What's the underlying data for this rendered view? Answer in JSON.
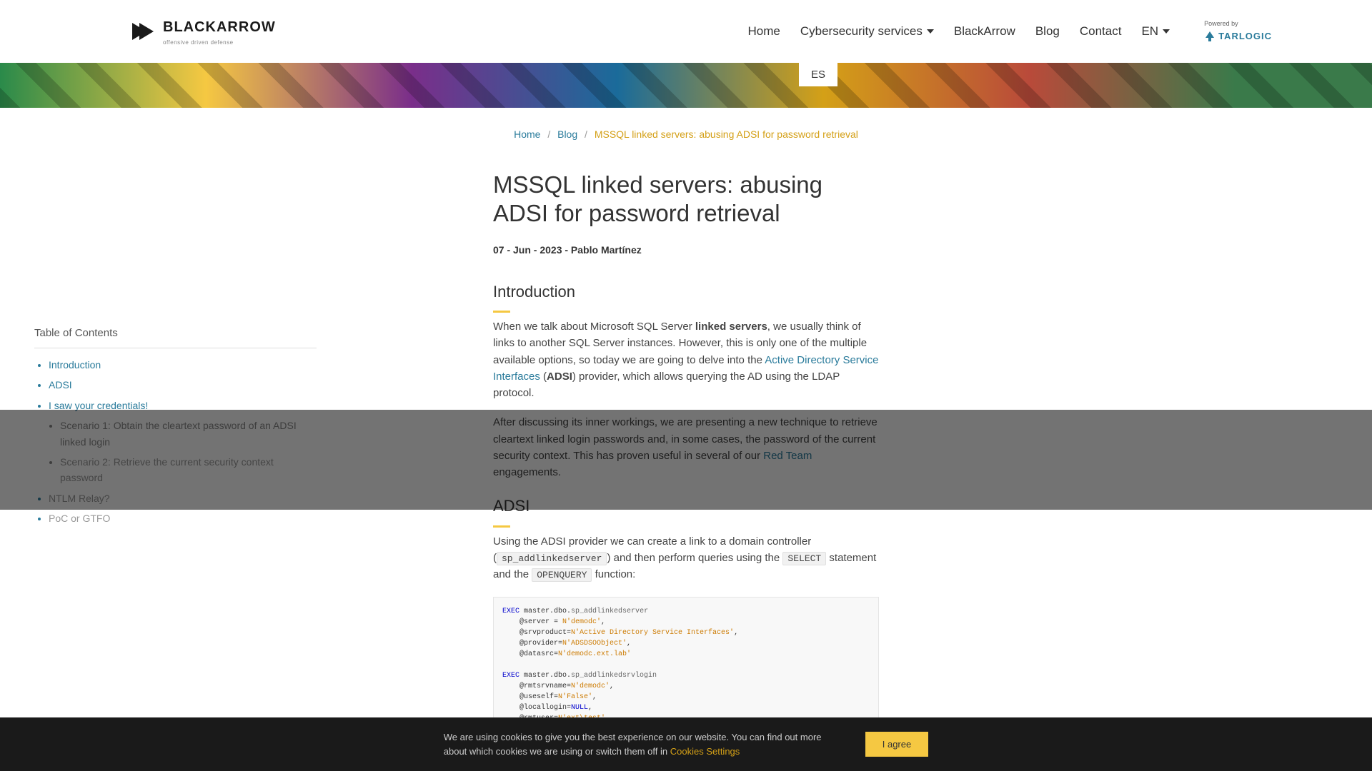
{
  "header": {
    "logo_main": "BLACKARROW",
    "logo_sub": "offensive driven defense",
    "nav": {
      "home": "Home",
      "services": "Cybersecurity services",
      "blackarrow": "BlackArrow",
      "blog": "Blog",
      "contact": "Contact",
      "lang": "EN"
    },
    "powered_label": "Powered by",
    "tarlogic": "TARLOGIC"
  },
  "lang_switch": "ES",
  "breadcrumb": {
    "home": "Home",
    "blog": "Blog",
    "current": "MSSQL linked servers: abusing ADSI for password retrieval"
  },
  "article": {
    "title": "MSSQL linked servers: abusing ADSI for password retrieval",
    "meta": "07 - Jun - 2023 - Pablo Martínez",
    "h_intro": "Introduction",
    "p1_a": "When we talk about Microsoft SQL Server ",
    "p1_strong": "linked servers",
    "p1_b": ", we usually think of links to another SQL Server instances. However, this is only one of the multiple available options, so today we are going to delve into the ",
    "p1_link": "Active Directory Service Interfaces",
    "p1_c": " (",
    "p1_strong2": "ADSI",
    "p1_d": ") provider, which allows querying the AD using the LDAP protocol.",
    "p2_a": "After discussing its inner workings, we are presenting a new technique to retrieve cleartext linked login passwords and, in some cases, the password of the current security context. This has proven useful in several of our ",
    "p2_link": "Red Team",
    "p2_b": " engagements.",
    "h_adsi": "ADSI",
    "p3_a": "Using the ADSI provider we can create a link to a domain controller (",
    "p3_code1": "sp_addlinkedserver",
    "p3_b": ") and then perform queries using the ",
    "p3_code2": "SELECT",
    "p3_c": " statement and the ",
    "p3_code3": "OPENQUERY",
    "p3_d": " function:"
  },
  "toc": {
    "title": "Table of Contents",
    "items": {
      "intro": "Introduction",
      "adsi": "ADSI",
      "creds": "I saw your credentials!",
      "s1": "Scenario 1: Obtain the cleartext password of an ADSI linked login",
      "s2": "Scenario 2: Retrieve the current security context password",
      "ntlm": "NTLM Relay?",
      "poc": "PoC or GTFO"
    }
  },
  "code": {
    "l1": "EXEC master.dbo.sp_addlinkedserver",
    "l2": "    @server = N'demodc',",
    "l3": "    @srvproduct=N'Active Directory Service Interfaces',",
    "l4": "    @provider=N'ADSDSOObject',",
    "l5": "    @datasrc=N'demodc.ext.lab'",
    "l6": "",
    "l7": "EXEC master.dbo.sp_addlinkedsrvlogin",
    "l8": "    @rmtsrvname=N'demodc',",
    "l9": "    @useself=N'False',",
    "l10": "    @locallogin=NULL,",
    "l11": "    @rmtuser=N'ext\\test',"
  },
  "cookie": {
    "text_a": "We are using cookies to give you the best experience on our website. You can find out more about which cookies we are using or switch them off in ",
    "link": "Cookies Settings",
    "btn": "I agree"
  }
}
